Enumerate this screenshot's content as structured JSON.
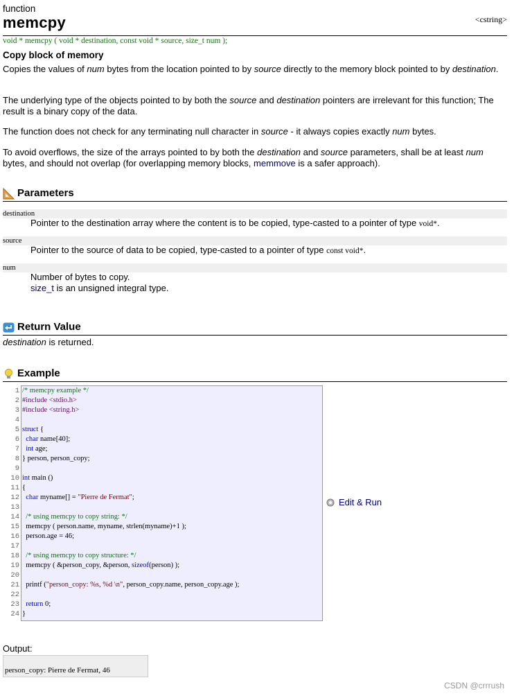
{
  "kind": "function",
  "title": "memcpy",
  "header": "<cstring>",
  "prototype": "void * memcpy ( void * destination, const void * source, size_t num );",
  "short_description": "Copy block of memory",
  "description": {
    "p1_a": "Copies the values of ",
    "p1_b": "num",
    "p1_c": " bytes from the location pointed to by ",
    "p1_d": "source",
    "p1_e": " directly to the memory block pointed to by ",
    "p1_f": "destination",
    "p1_g": ".",
    "p2_a": "The underlying type of the objects pointed to by both the ",
    "p2_b": "source",
    "p2_c": " and ",
    "p2_d": "destination",
    "p2_e": " pointers are irrelevant for this function; The result is a binary copy of the data.",
    "p3_a": "The function does not check for any terminating null character in ",
    "p3_b": "source",
    "p3_c": " - it always copies exactly ",
    "p3_d": "num",
    "p3_e": " bytes.",
    "p4_a": "To avoid overflows, the size of the arrays pointed to by both the ",
    "p4_b": "destination",
    "p4_c": " and ",
    "p4_d": "source",
    "p4_e": " parameters, shall be at least ",
    "p4_f": "num",
    "p4_g": " bytes, and should not overlap (for overlapping memory blocks, ",
    "p4_link": "memmove",
    "p4_h": " is a safer approach)."
  },
  "sections": {
    "parameters": "Parameters",
    "return_value": "Return Value",
    "example": "Example"
  },
  "parameters": [
    {
      "name": "destination",
      "desc": "Pointer to the destination array where the content is to be copied, type-casted to a pointer of type ",
      "type": "void*",
      "end": "."
    },
    {
      "name": "source",
      "desc": "Pointer to the source of data to be copied, type-casted to a pointer of type ",
      "type": "const void*",
      "end": "."
    },
    {
      "name": "num",
      "desc": "Number of bytes to copy.",
      "link": "size_t",
      "desc2": " is an unsigned integral type."
    }
  ],
  "return_value": {
    "name": "destination",
    "text": " is returned."
  },
  "code_lines": [
    "/* memcpy example */",
    "#include <stdio.h>",
    "#include <string.h>",
    "",
    "struct {",
    "  char name[40];",
    "  int age;",
    "} person, person_copy;",
    "",
    "int main ()",
    "{",
    "  char myname[] = \"Pierre de Fermat\";",
    "",
    "  /* using memcpy to copy string: */",
    "  memcpy ( person.name, myname, strlen(myname)+1 );",
    "  person.age = 46;",
    "",
    "  /* using memcpy to copy structure: */",
    "  memcpy ( &person_copy, &person, sizeof(person) );",
    "",
    "  printf (\"person_copy: %s, %d \\n\", person_copy.name, person_copy.age );",
    "",
    "  return 0;",
    "}"
  ],
  "edit_run": "Edit & Run",
  "output_label": "Output:",
  "output_text": "person_copy: Pierre de Fermat, 46",
  "watermark": "CSDN @crrrush"
}
